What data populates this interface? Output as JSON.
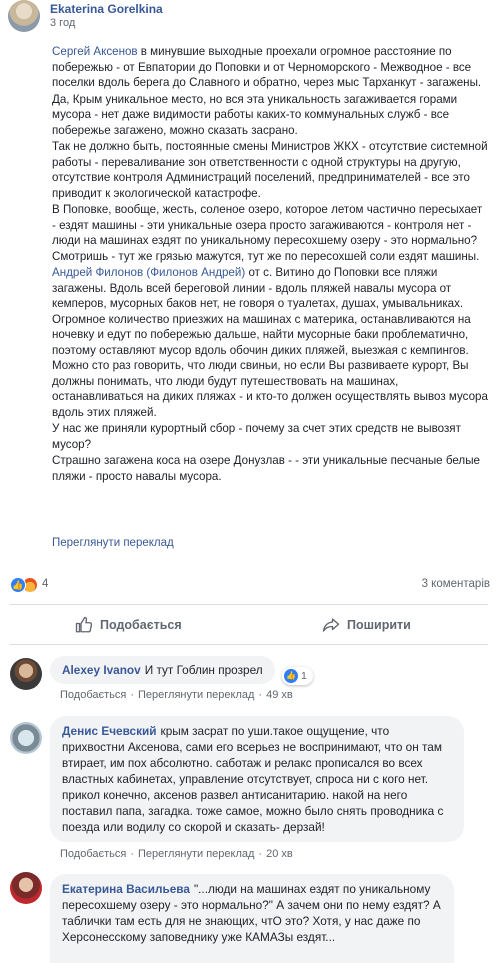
{
  "post": {
    "author": "Ekaterina Gorelkina",
    "time": "3 год",
    "paragraphs": [
      "Сергей Аксенов в минувшие выходные проехали огромное расстояние по побережью - от Евпатории до Поповки и от Черноморского - Межводное - все поселки вдоль берега до Славного и обратно, через мыс Тарханкут - загажены.",
      "Да, Крым уникальное место, но вся эта уникальность загаживается горами мусора - нет даже видимости работы каких-то коммунальных служб - все побережье загажено, можно сказать засрано.",
      "Так не должно быть, постоянные смены Министров ЖКХ - отсутствие системной работы - перевaливание зон ответственности с одной структуры на другую, отсутствие контроля Администраций поселений, предпринимателей - все это приводит к экологической катастрофе.",
      "В Поповке, вообще, жесть, соленое озеро, которое летом частично пересыхает - ездят машины - эти уникальные озера просто загаживаются - контроля нет - люди на машинах ездят по уникальному пересохшему озеру - это нормально? Смотришь - тут же грязью мажутся, тут же по пересохшей соли ездят машины.",
      "от с. Витино до Поповки все пляжи загажены. Вдоль всей береговой линии - вдоль пляжей навалы мусора от кемперов, мусорных баков нет, не говоря о туалетах, душах, умывальниках. Огромное количество приезжих на машинах с материка, останавливаются на ночевку и едут по побережью дальше, найти мусорные баки проблематично, поэтому оставляют мусор вдоль обочин диких пляжей, выезжая с кемпингов. Можно сто раз говорить, что люди свиньи, но если Вы развиваете курорт, Вы должны понимать, что люди будут путешествовать на машинах, останавливаться на диких пляжах - и кто-то должен осуществлять вывоз мусора вдоль этих пляжей.",
      "У нас же приняли курортный сбор - почему за счет этих средств не вывозят мусор?",
      "Страшно загажена коса на озере Донузлав - - эти уникальные песчаные белые пляжи - просто навалы мусора."
    ],
    "mention_1": "Сергей Аксенов",
    "mention_2": "Андрей Филонов (Филонов Андрей)",
    "translate_link": "Переглянути переклад",
    "reaction_count": "4",
    "comments_count": "3 коментарів",
    "like_action": "Подобається",
    "share_action": "Поширити"
  },
  "comments": [
    {
      "author": "Alexey Ivanov",
      "text": "И тут Гоблин прозрел",
      "reactions": "1",
      "actions": [
        "Подобається",
        "Переглянути переклад"
      ],
      "time": "49 хв"
    },
    {
      "author": "Денис Ечевский",
      "text": "крым засрат по уши.такое ощущение, что прихвостни Аксенова, сами его всерьез не воспринимают, что он там втирает, им пох абсолютно. саботаж и релакс прописался во всех властных кабинетах, управление отсутствует, спроса ни с кого нет. прикол конечно, аксенов развел антисанитарию. накой на него поставил папа, загадка. тоже самое, можно было снять проводника с поезда или водилу со скорой и сказать- дерзай!",
      "actions": [
        "Подобається",
        "Переглянути переклад"
      ],
      "time": "20 хв"
    },
    {
      "author": "Екатерина Васильева",
      "text": "\"...люди на машинах ездят по уникальному пересохшему озеру - это нормально?\" А зачем они по нему ездят? А таблички там есть для не знающих, чтО это? Хотя, у нас даже по Херсонесскому заповеднику уже КАМАЗы ездят..."
    }
  ],
  "colors": {
    "link": "#385898",
    "meta": "#606770",
    "bubble": "#f2f3f5",
    "like_blue": "#2d7ff9"
  }
}
